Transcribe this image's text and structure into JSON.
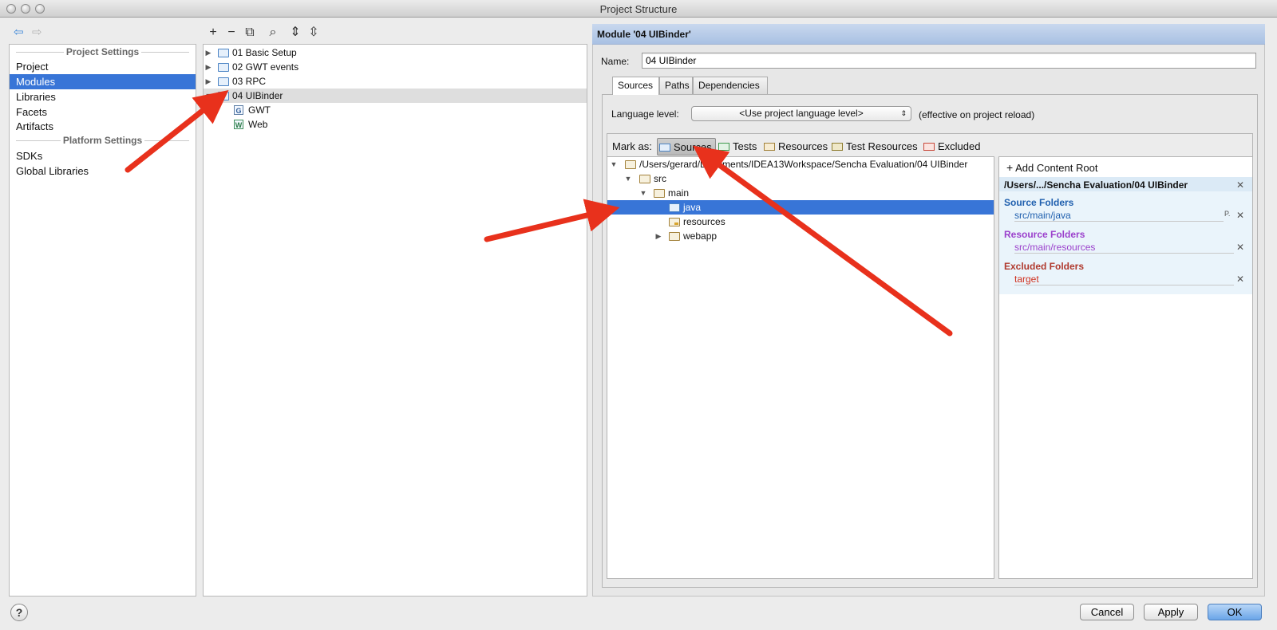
{
  "window": {
    "title": "Project Structure"
  },
  "nav": {
    "back": "⇦",
    "forward": "⇨"
  },
  "settings": {
    "project_header": "Project Settings",
    "project_items": [
      "Project",
      "Modules",
      "Libraries",
      "Facets",
      "Artifacts"
    ],
    "platform_header": "Platform Settings",
    "platform_items": [
      "SDKs",
      "Global Libraries"
    ]
  },
  "modules": {
    "toolbar": {
      "add": "+",
      "remove": "−",
      "copy": "⧉",
      "find": "⌕",
      "expand": "⇕",
      "collapse": "⇳"
    },
    "tree": [
      {
        "label": "01 Basic Setup"
      },
      {
        "label": "02 GWT events"
      },
      {
        "label": "03 RPC"
      },
      {
        "label": "04 UIBinder"
      },
      {
        "label": "GWT",
        "icon": "G"
      },
      {
        "label": "Web",
        "icon": "W"
      }
    ]
  },
  "module": {
    "header": "Module '04 UIBinder'",
    "name_label": "Name:",
    "name_value": "04 UIBinder",
    "tabs": [
      "Sources",
      "Paths",
      "Dependencies"
    ],
    "language_label": "Language level:",
    "language_value": "<Use project language level>",
    "language_note": "(effective on project reload)",
    "mark_as": "Mark as:",
    "marks": [
      "Sources",
      "Tests",
      "Resources",
      "Test Resources",
      "Excluded"
    ],
    "source_tree": [
      "/Users/gerard/Documents/IDEA13Workspace/Sencha Evaluation/04 UIBinder",
      "src",
      "main",
      "java",
      "resources",
      "webapp"
    ],
    "add_root": "Add Content Root",
    "root_path": "/Users/.../Sencha Evaluation/04 UIBinder",
    "source_folders_header": "Source Folders",
    "source_folder": "src/main/java",
    "resource_folders_header": "Resource Folders",
    "resource_folder": "src/main/resources",
    "excluded_folders_header": "Excluded Folders",
    "excluded_folder": "target",
    "close_glyph": "✕",
    "edit_glyph": "P."
  },
  "footer": {
    "help": "?",
    "cancel": "Cancel",
    "apply": "Apply",
    "ok": "OK"
  },
  "colors": {
    "selection": "#3875d7",
    "source": "#1f5fae",
    "resource": "#9b40cc",
    "excluded": "#b03a2e",
    "arrow": "#e8311c"
  }
}
